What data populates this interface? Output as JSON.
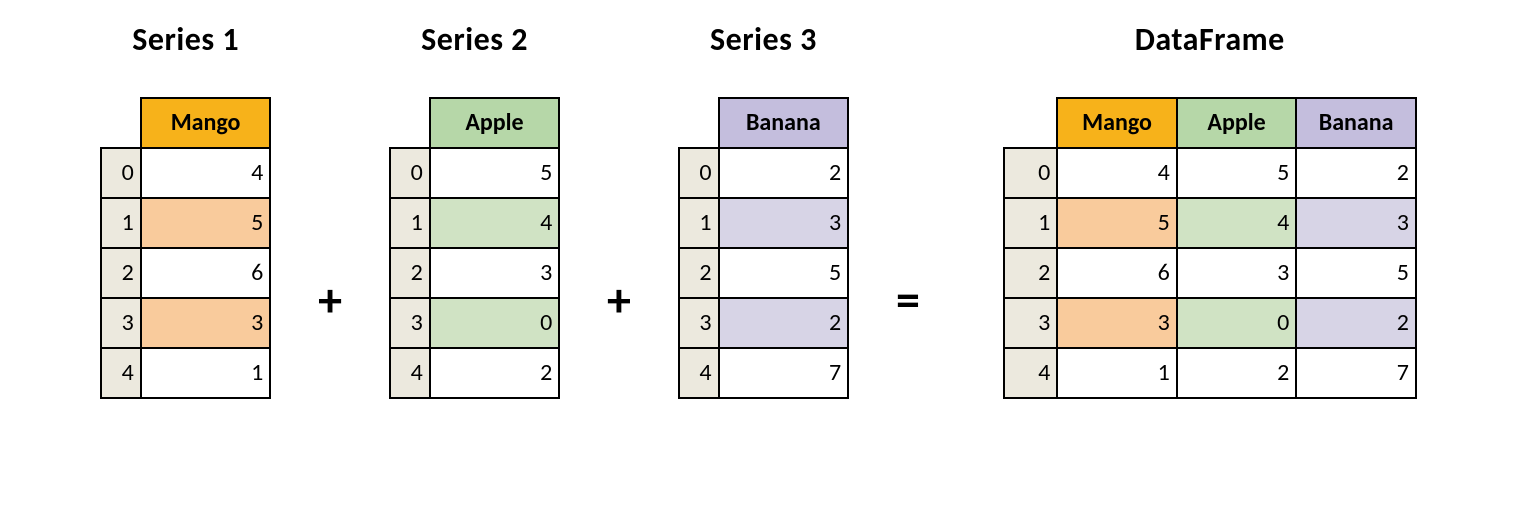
{
  "titles": {
    "s1": "Series 1",
    "s2": "Series 2",
    "s3": "Series 3",
    "df": "DataFrame"
  },
  "operators": {
    "plus1": "+",
    "plus2": "+",
    "equals": "="
  },
  "colors": {
    "mango_header": "#f7b21a",
    "apple_header": "#b6d7a8",
    "banana_header": "#c4bedd",
    "mango_shade": "#f9cb9c",
    "apple_shade": "#d0e3c4",
    "banana_shade": "#d7d4e6",
    "index_bg": "#ece9de"
  },
  "index": [
    "0",
    "1",
    "2",
    "3",
    "4"
  ],
  "series": {
    "mango": {
      "header": "Mango",
      "values": [
        "4",
        "5",
        "6",
        "3",
        "1"
      ],
      "shaded_rows": [
        1,
        3
      ]
    },
    "apple": {
      "header": "Apple",
      "values": [
        "5",
        "4",
        "3",
        "0",
        "2"
      ],
      "shaded_rows": [
        1,
        3
      ]
    },
    "banana": {
      "header": "Banana",
      "values": [
        "2",
        "3",
        "5",
        "2",
        "7"
      ],
      "shaded_rows": [
        1,
        3
      ]
    }
  },
  "dataframe": {
    "columns": [
      "Mango",
      "Apple",
      "Banana"
    ],
    "rows": [
      {
        "idx": "0",
        "mango": "4",
        "apple": "5",
        "banana": "2"
      },
      {
        "idx": "1",
        "mango": "5",
        "apple": "4",
        "banana": "3"
      },
      {
        "idx": "2",
        "mango": "6",
        "apple": "3",
        "banana": "5"
      },
      {
        "idx": "3",
        "mango": "3",
        "apple": "0",
        "banana": "2"
      },
      {
        "idx": "4",
        "mango": "1",
        "apple": "2",
        "banana": "7"
      }
    ],
    "shaded_rows": [
      1,
      3
    ]
  }
}
